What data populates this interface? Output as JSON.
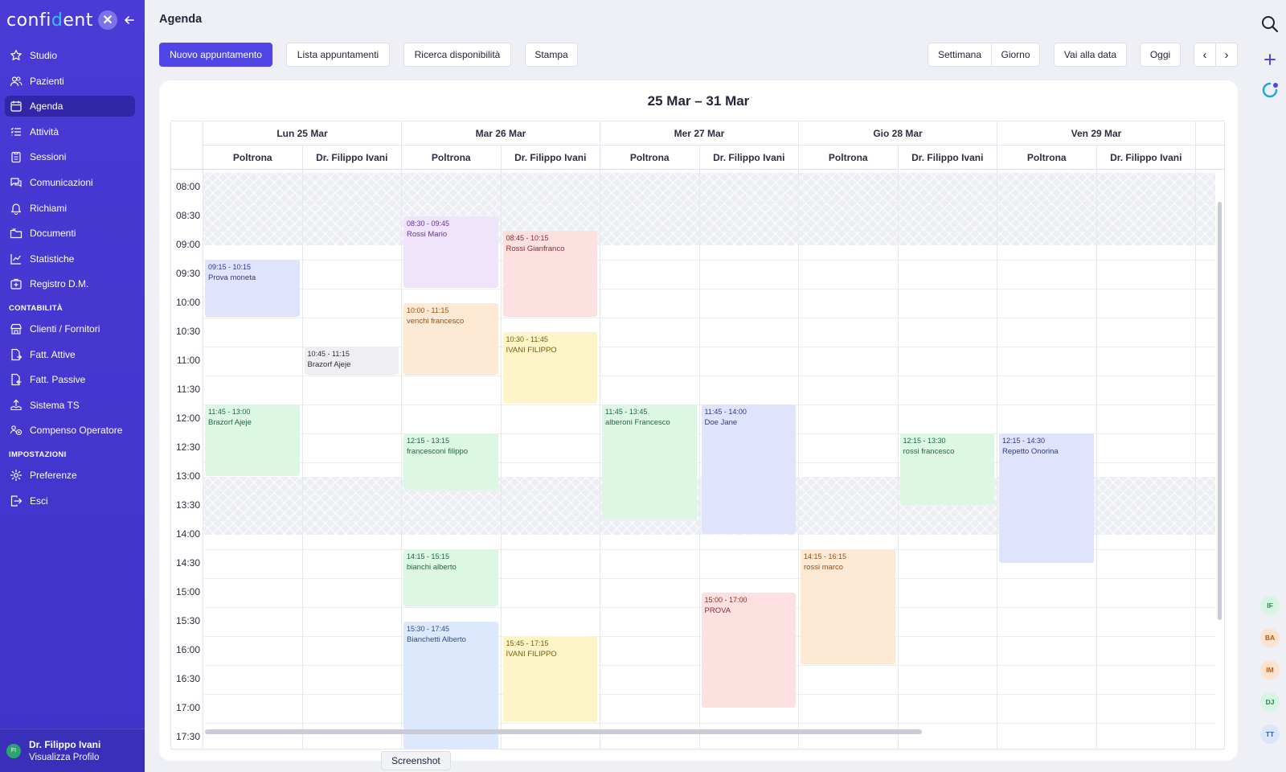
{
  "brand": {
    "logo_prefix": "confi",
    "logo_accent": "d",
    "logo_suffix": "ent",
    "logo_mark": "✕"
  },
  "sidebar": {
    "items": [
      {
        "label": "Studio",
        "icon": "star-icon"
      },
      {
        "label": "Pazienti",
        "icon": "users-icon"
      },
      {
        "label": "Agenda",
        "icon": "calendar-icon",
        "active": true
      },
      {
        "label": "Attività",
        "icon": "list-icon"
      },
      {
        "label": "Sessioni",
        "icon": "clipboard-icon"
      },
      {
        "label": "Comunicazioni",
        "icon": "chat-icon"
      },
      {
        "label": "Richiami",
        "icon": "bell-icon"
      },
      {
        "label": "Documenti",
        "icon": "folder-icon"
      },
      {
        "label": "Statistiche",
        "icon": "chart-icon"
      },
      {
        "label": "Registro D.M.",
        "icon": "register-icon"
      }
    ],
    "section_accounting": "CONTABILITÀ",
    "accounting_items": [
      {
        "label": "Clienti / Fornitori",
        "icon": "store-icon"
      },
      {
        "label": "Fatt. Attive",
        "icon": "invoice-out-icon"
      },
      {
        "label": "Fatt. Passive",
        "icon": "invoice-in-icon"
      },
      {
        "label": "Sistema TS",
        "icon": "upload-icon"
      },
      {
        "label": "Compenso Operatore",
        "icon": "operator-icon"
      }
    ],
    "section_settings": "IMPOSTAZIONI",
    "settings_items": [
      {
        "label": "Preferenze",
        "icon": "gear-icon"
      },
      {
        "label": "Esci",
        "icon": "logout-icon"
      }
    ],
    "profile": {
      "initials": "FI",
      "name": "Dr. Filippo Ivani",
      "link": "Visualizza Profilo"
    }
  },
  "header": {
    "title": "Agenda",
    "buttons": {
      "new_appointment": "Nuovo appuntamento",
      "appointment_list": "Lista appuntamenti",
      "availability_search": "Ricerca disponibilità",
      "print": "Stampa",
      "week": "Settimana",
      "day": "Giorno",
      "go_to_date": "Vai alla data",
      "today": "Oggi",
      "prev": "‹",
      "next": "›"
    }
  },
  "calendar": {
    "range_title": "25 Mar – 31 Mar",
    "days": [
      "Lun 25 Mar",
      "Mar 26 Mar",
      "Mer 27 Mar",
      "Gio 28 Mar",
      "Ven 29 Mar"
    ],
    "resources": [
      "Poltrona",
      "Dr. Filippo Ivani"
    ],
    "time_labels": [
      "08:00",
      "08:30",
      "09:00",
      "09:30",
      "10:00",
      "10:30",
      "11:00",
      "11:30",
      "12:00",
      "12:30",
      "13:00",
      "13:30",
      "14:00",
      "14:30",
      "15:00",
      "15:30",
      "16:00",
      "16:30",
      "17:00",
      "17:30"
    ],
    "closed_ranges": [
      [
        "07:45",
        "09:00"
      ],
      [
        "13:00",
        "14:00"
      ]
    ],
    "appointments": [
      {
        "day": 0,
        "res": 0,
        "start": "09:15",
        "end": "10:15",
        "time": "09:15 - 10:15",
        "name": "Prova moneta",
        "color": "#dfe3fb"
      },
      {
        "day": 0,
        "res": 1,
        "start": "10:45",
        "end": "11:15",
        "time": "10:45 - 11:15",
        "name": "Brazorf Ajeje",
        "color": "#efeff2"
      },
      {
        "day": 0,
        "res": 0,
        "start": "11:45",
        "end": "13:00",
        "time": "11:45 - 13:00",
        "name": "Brazorf Ajeje",
        "color": "#dcf7e3"
      },
      {
        "day": 1,
        "res": 0,
        "start": "08:30",
        "end": "09:45",
        "time": "08:30 - 09:45",
        "name": "Rossi Mario",
        "color": "#efe4fb"
      },
      {
        "day": 1,
        "res": 1,
        "start": "08:45",
        "end": "10:15",
        "time": "08:45 - 10:15",
        "name": "Rossi Gianfranco",
        "color": "#fde0e0"
      },
      {
        "day": 1,
        "res": 0,
        "start": "10:00",
        "end": "11:15",
        "time": "10:00 - 11:15",
        "name": "venchi francesco",
        "color": "#fde9d4"
      },
      {
        "day": 1,
        "res": 1,
        "start": "10:30",
        "end": "11:45",
        "time": "10:30 - 11:45",
        "name": "IVANI FILIPPO",
        "color": "#fdf4c8"
      },
      {
        "day": 1,
        "res": 0,
        "start": "12:15",
        "end": "13:15",
        "time": "12:15 - 13:15",
        "name": "francesconi filippo",
        "color": "#dcf7e3"
      },
      {
        "day": 1,
        "res": 0,
        "start": "14:15",
        "end": "15:15",
        "time": "14:15 - 15:15",
        "name": "bianchi alberto",
        "color": "#dcf7e3"
      },
      {
        "day": 1,
        "res": 0,
        "start": "15:30",
        "end": "17:45",
        "time": "15:30 - 17:45",
        "name": "Bianchetti Alberto",
        "color": "#dce8fb"
      },
      {
        "day": 1,
        "res": 1,
        "start": "15:45",
        "end": "17:15",
        "time": "15:45 - 17:15",
        "name": "IVANI FILIPPO",
        "color": "#fdf4c8"
      },
      {
        "day": 2,
        "res": 0,
        "start": "11:45",
        "end": "13:45",
        "time": "11:45 - 13:45",
        "name": "alberoni Francesco",
        "color": "#dcf7e3"
      },
      {
        "day": 2,
        "res": 1,
        "start": "11:45",
        "end": "14:00",
        "time": "11:45 - 14:00",
        "name": "Doe Jane",
        "color": "#dfe3fb"
      },
      {
        "day": 2,
        "res": 1,
        "start": "15:00",
        "end": "17:00",
        "time": "15:00 - 17:00",
        "name": "PROVA",
        "color": "#fde0e0"
      },
      {
        "day": 3,
        "res": 1,
        "start": "12:15",
        "end": "13:30",
        "time": "12:15 - 13:30",
        "name": "rossi francesco",
        "color": "#dcf7e3"
      },
      {
        "day": 3,
        "res": 0,
        "start": "14:15",
        "end": "16:15",
        "time": "14:15 - 16:15",
        "name": "rossi marco",
        "color": "#fde9d4"
      },
      {
        "day": 4,
        "res": 0,
        "start": "12:15",
        "end": "14:30",
        "time": "12:15 - 14:30",
        "name": "Repetto Onorina",
        "color": "#dfe3fb"
      }
    ]
  },
  "rail": {
    "avatars": [
      {
        "initials": "IF",
        "bg": "#d6f5e2",
        "fg": "#1f8a52"
      },
      {
        "initials": "BA",
        "bg": "#fde3cf",
        "fg": "#b45a13"
      },
      {
        "initials": "IM",
        "bg": "#fde3cf",
        "fg": "#b45a13"
      },
      {
        "initials": "DJ",
        "bg": "#d6f5e2",
        "fg": "#1f8a52"
      },
      {
        "initials": "TT",
        "bg": "#dbe6fb",
        "fg": "#2f5fb3"
      }
    ]
  },
  "tooltip": "Screenshot",
  "colors": {
    "accent": "#4f46e5",
    "sidebar": "#4338ca"
  }
}
